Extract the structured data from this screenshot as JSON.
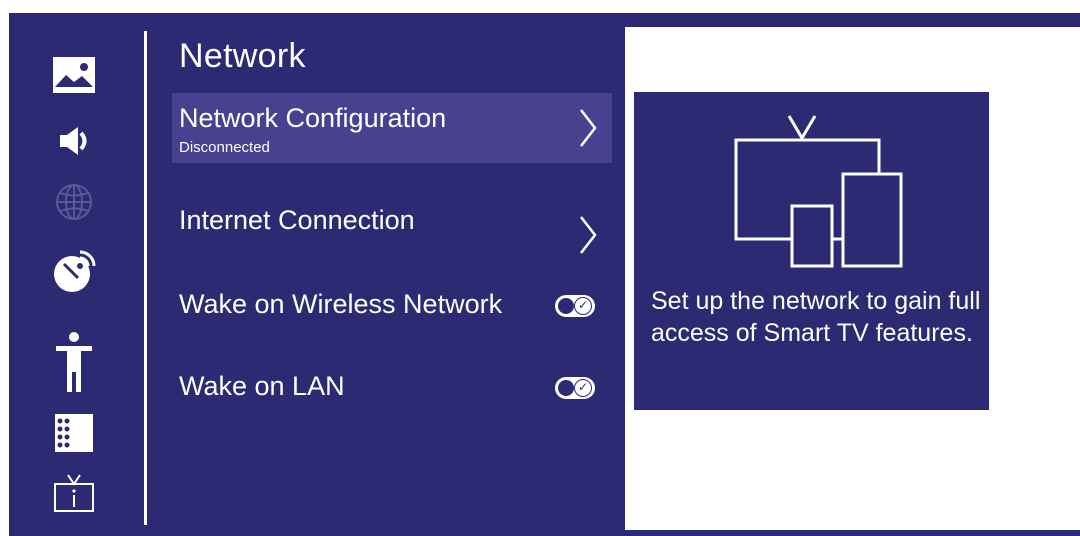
{
  "rail": {
    "icons": [
      {
        "name": "picture-icon",
        "active": true
      },
      {
        "name": "sound-icon",
        "active": true
      },
      {
        "name": "globe-icon",
        "active": false
      },
      {
        "name": "satellite-dish-icon",
        "active": true
      },
      {
        "name": "accessibility-icon",
        "active": true
      },
      {
        "name": "remote-apps-icon",
        "active": true
      },
      {
        "name": "tv-info-icon",
        "active": true
      }
    ]
  },
  "menu": {
    "title": "Network",
    "items": [
      {
        "label": "Network Configuration",
        "sub": "Disconnected",
        "control": "chevron",
        "selected": true
      },
      {
        "label": "Internet Connection",
        "sub": "",
        "control": "chevron",
        "selected": false
      },
      {
        "label": "Wake on Wireless Network",
        "control": "toggle",
        "toggle_on": true,
        "selected": false
      },
      {
        "label": "Wake on LAN",
        "control": "toggle",
        "toggle_on": true,
        "selected": false
      }
    ]
  },
  "info": {
    "illustration": "tv-and-devices-icon",
    "text": "Set up the network to gain full access of Smart TV features."
  },
  "colors": {
    "background": "#2b2a72",
    "selected": "#47418f",
    "foreground": "#ffffff",
    "disabled": "#5a5998"
  }
}
